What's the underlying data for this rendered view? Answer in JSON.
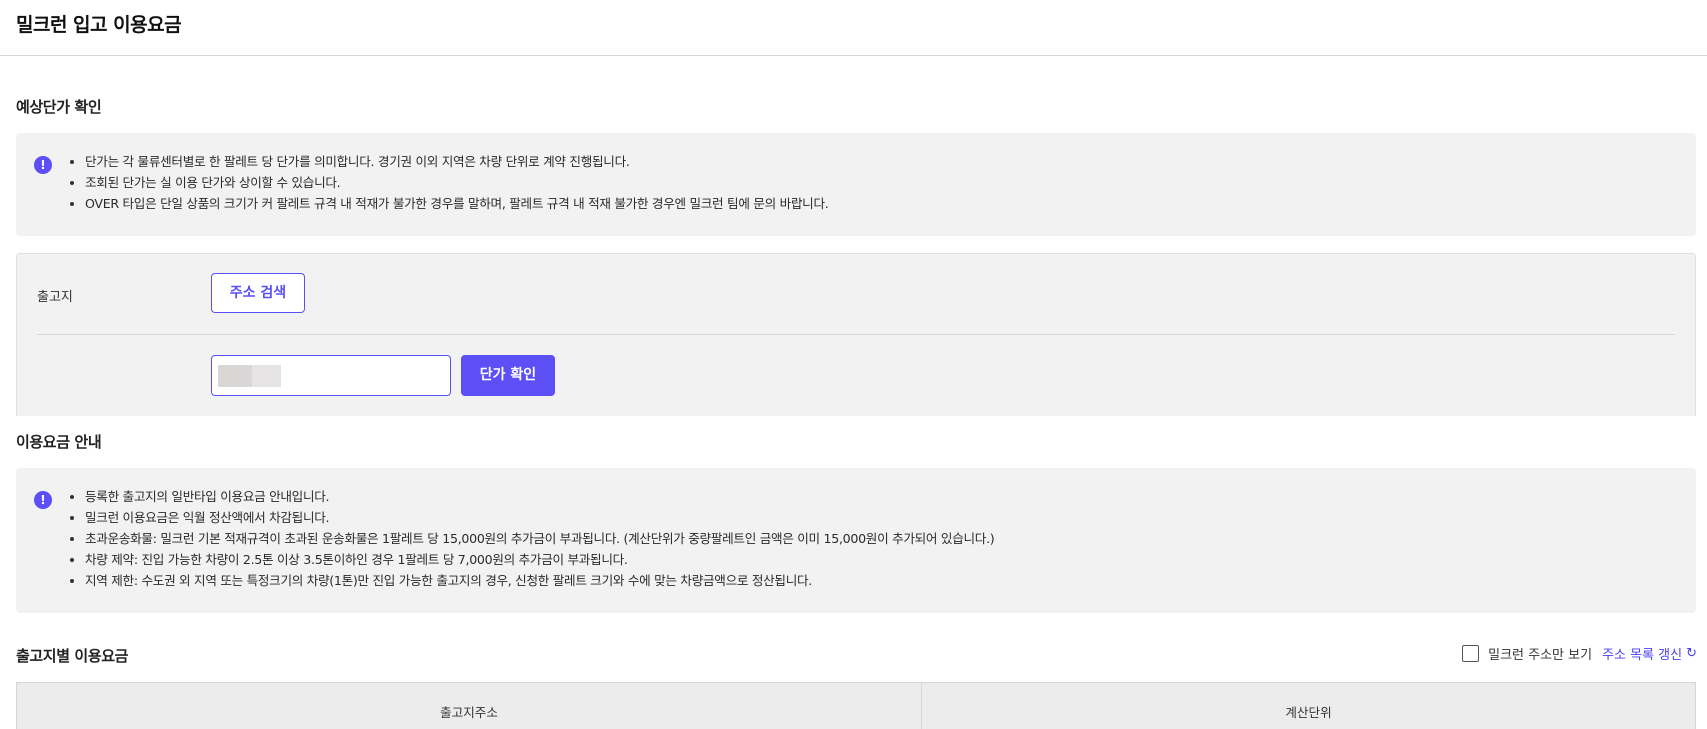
{
  "page": {
    "title": "밀크런 입고 이용요금"
  },
  "price_check": {
    "section_title": "예상단가 확인",
    "notice_icon": "exclamation-icon",
    "notices": [
      "단가는 각 물류센터별로 한 팔레트 당 단가를 의미합니다. 경기권 이외 지역은 차량 단위로 계약 진행됩니다.",
      "조회된 단가는 실 이용 단가와 상이할 수 있습니다.",
      "OVER 타입은 단일 상품의 크기가 커 팔레트 규격 내 적재가 불가한 경우를 말하며, 팔레트 규격 내 적재 불가한 경우엔 밀크런 팀에 문의 바랍니다."
    ],
    "origin_label": "출고지",
    "address_search_button": "주소 검색",
    "price_check_button": "단가 확인"
  },
  "fee_info": {
    "section_title": "이용요금 안내",
    "notices": [
      "등록한 출고지의 일반타입 이용요금 안내입니다.",
      "밀크런 이용요금은 익월 정산액에서 차감됩니다.",
      "초과운송화물: 밀크런 기본 적재규격이 초과된 운송화물은 1팔레트 당 15,000원의 추가금이 부과됩니다. (계산단위가 중량팔레트인 금액은 이미 15,000원이 추가되어 있습니다.)",
      "차량 제약: 진입 가능한 차량이 2.5톤 이상 3.5톤이하인 경우 1팔레트 당 7,000원의 추가금이 부과됩니다.",
      "지역 제한: 수도권 외 지역 또는 특정크기의 차량(1톤)만 진입 가능한 출고지의 경우, 신청한 팔레트 크기와 수에 맞는 차량금액으로 정산됩니다."
    ]
  },
  "origin_fees": {
    "section_title": "출고지별 이용요금",
    "only_milkrun_label": "밀크런 주소만 보기",
    "only_milkrun_checked": false,
    "refresh_label": "주소 목록 갱신",
    "refresh_icon": "refresh-icon",
    "columns": [
      "출고지주소",
      "계산단위"
    ]
  },
  "colors": {
    "accent": "#5b4ff5",
    "panel_bg": "#f2f2f3"
  }
}
